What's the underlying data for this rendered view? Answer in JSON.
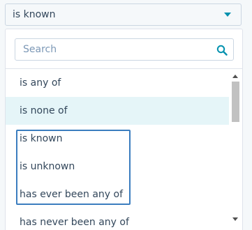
{
  "select": {
    "value": "is known",
    "caret_color": "#0091ae"
  },
  "dropdown": {
    "search": {
      "placeholder": "Search",
      "value": ""
    },
    "options": [
      {
        "label": "is any of",
        "state": "normal"
      },
      {
        "label": "is none of",
        "state": "hover"
      },
      {
        "label": "is known",
        "state": "normal"
      },
      {
        "label": "is unknown",
        "state": "normal"
      },
      {
        "label": "has ever been any of",
        "state": "normal"
      },
      {
        "label": "has never been any of",
        "state": "normal"
      }
    ],
    "highlight_color": "#3b7dbf"
  },
  "colors": {
    "text": "#33475b",
    "hover_bg": "#e5f5f8",
    "border": "#cbd6e2",
    "accent": "#0091ae"
  },
  "icons": {
    "search": "search-icon",
    "caret": "caret-down-icon"
  }
}
